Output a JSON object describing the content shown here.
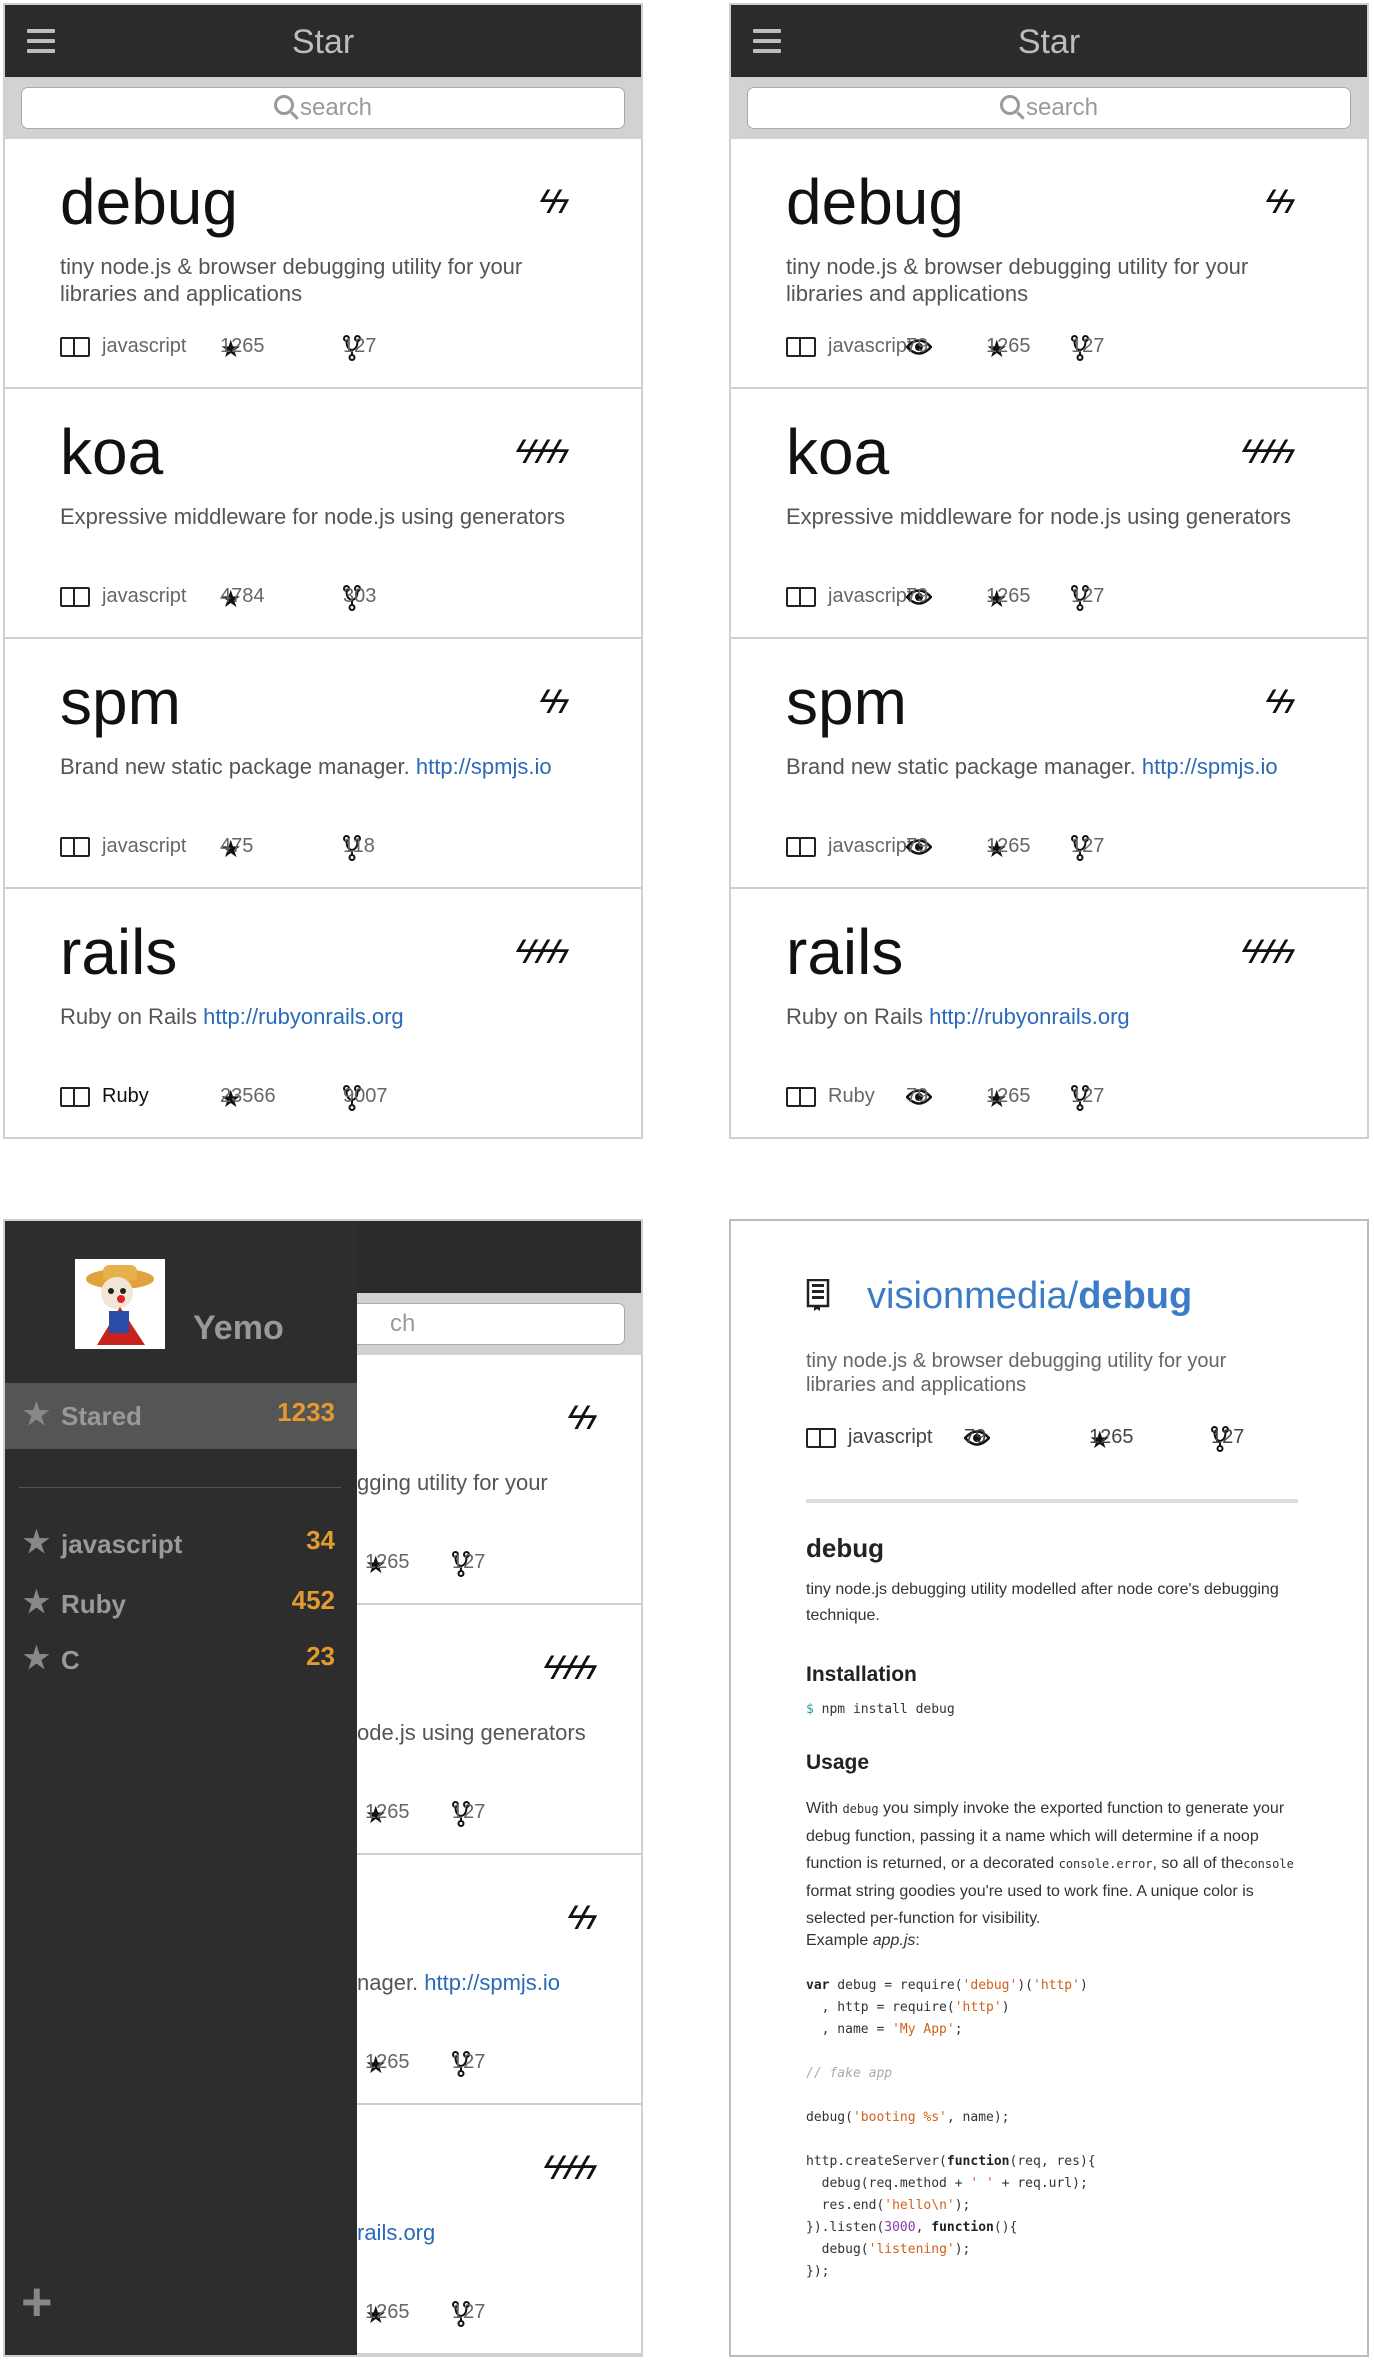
{
  "app": {
    "title": "Star",
    "search_placeholder": "search"
  },
  "list1": [
    {
      "name": "debug",
      "bolts": "ϟϟ",
      "desc": "tiny node.js & browser debugging utility for your libraries and applications",
      "link": "",
      "lang": "javascript",
      "stars": "1265",
      "forks": "127"
    },
    {
      "name": "koa",
      "bolts": "ϟϟϟϟ",
      "desc": "Expressive middleware for node.js using generators",
      "link": "",
      "lang": "javascript",
      "stars": "4784",
      "forks": "303"
    },
    {
      "name": "spm",
      "bolts": "ϟϟ",
      "desc": "Brand new static package manager.",
      "link": "http://spmjs.io",
      "lang": "javascript",
      "stars": "475",
      "forks": "118"
    },
    {
      "name": "rails",
      "bolts": "ϟϟϟϟ",
      "desc": "Ruby on Rails ",
      "link": "http://rubyonrails.org",
      "lang": "Ruby",
      "stars": "23566",
      "forks": "9007"
    }
  ],
  "list2": [
    {
      "name": "debug",
      "bolts": "ϟϟ",
      "desc": "tiny node.js & browser debugging utility for your libraries and applications",
      "link": "",
      "lang": "javascript",
      "watch": "79",
      "stars": "1265",
      "forks": "127"
    },
    {
      "name": "koa",
      "bolts": "ϟϟϟϟ",
      "desc": "Expressive middleware for node.js using generators",
      "link": "",
      "lang": "javascript",
      "watch": "79",
      "stars": "1265",
      "forks": "127"
    },
    {
      "name": "spm",
      "bolts": "ϟϟ",
      "desc": "Brand new static package manager.",
      "link": "http://spmjs.io",
      "lang": "javascript",
      "watch": "79",
      "stars": "1265",
      "forks": "127"
    },
    {
      "name": "rails",
      "bolts": "ϟϟϟϟ",
      "desc": "Ruby on Rails ",
      "link": "http://rubyonrails.org",
      "lang": "Ruby",
      "watch": "79",
      "stars": "1265",
      "forks": "127"
    }
  ],
  "sidebar": {
    "username": "Yemo",
    "stared_label": "Stared",
    "stared_count": "1233",
    "items": [
      {
        "label": "javascript",
        "count": "34"
      },
      {
        "label": "Ruby",
        "count": "452"
      },
      {
        "label": "C",
        "count": "23"
      }
    ],
    "add": "+"
  },
  "behind": {
    "search_partial": "ch",
    "cards": [
      {
        "bolts": "ϟϟ",
        "desc": "gging utility for your",
        "stars": "1265",
        "forks": "127"
      },
      {
        "bolts": "ϟϟϟϟ",
        "desc": "ode.js using generators",
        "stars": "1265",
        "forks": "127"
      },
      {
        "bolts": "ϟϟ",
        "desc": "nager.",
        "link": "http://spmjs.io",
        "stars": "1265",
        "forks": "127"
      },
      {
        "bolts": "ϟϟϟϟ",
        "desc": "",
        "link": "rails.org",
        "stars": "1265",
        "forks": "127"
      }
    ]
  },
  "detail": {
    "owner": "visionmedia",
    "sep": "/",
    "repo": "debug",
    "desc": "tiny node.js & browser debugging utility for your libraries and applications",
    "lang": "javascript",
    "watch": "79",
    "stars": "1265",
    "forks": "127",
    "h_main": "debug",
    "p_main": "tiny node.js debugging utility modelled after node core's debugging technique.",
    "h_install": "Installation",
    "install_prompt": "$",
    "install_cmd": " npm install debug",
    "h_usage": "Usage",
    "usage_1": "With ",
    "usage_code1": "debug",
    "usage_2": " you simply invoke the exported function to generate your debug function, passing it a name which will determine if a noop function is returned, or a decorated ",
    "usage_code2": "console.error",
    "usage_3": ", so all of the",
    "usage_code3": "console",
    "usage_4": " format string goodies you're used to work fine. A unique color is selected per-function for visibility.",
    "example_label": "Example ",
    "example_file": "app.js",
    ":": ":"
  }
}
